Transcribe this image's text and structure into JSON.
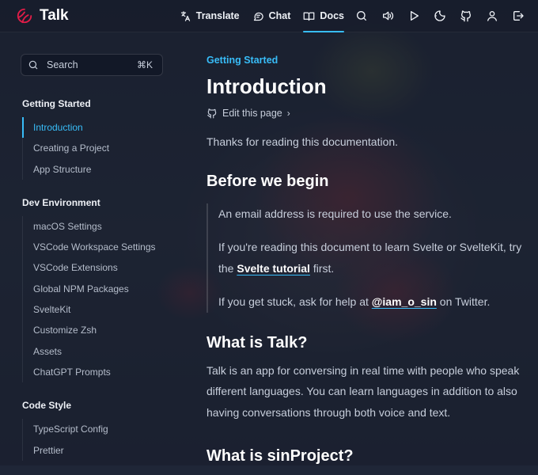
{
  "app": {
    "name": "Talk"
  },
  "nav": {
    "translate": "Translate",
    "chat": "Chat",
    "docs": "Docs"
  },
  "icons": [
    "logo-mark",
    "translate-icon",
    "chat-icon",
    "book-icon",
    "search-icon",
    "speaker-icon",
    "play-icon",
    "moon-icon",
    "github-icon",
    "user-icon",
    "logout-icon"
  ],
  "colors": {
    "accent": "#38bdf8",
    "heading": "#ffffff",
    "text": "#c7cedb",
    "logo": "#e11d48"
  },
  "search": {
    "label": "Search",
    "shortcut": "⌘K"
  },
  "sidebar": {
    "groups": [
      {
        "title": "Getting Started",
        "items": [
          "Introduction",
          "Creating a Project",
          "App Structure"
        ]
      },
      {
        "title": "Dev Environment",
        "items": [
          "macOS Settings",
          "VSCode Workspace Settings",
          "VSCode Extensions",
          "Global NPM Packages",
          "SvelteKit",
          "Customize Zsh",
          "Assets",
          "ChatGPT Prompts"
        ]
      },
      {
        "title": "Code Style",
        "items": [
          "TypeScript Config",
          "Prettier"
        ]
      }
    ],
    "active_item": "Introduction"
  },
  "main": {
    "eyebrow": "Getting Started",
    "title": "Introduction",
    "edit_link": "Edit this page",
    "intro": "Thanks for reading this documentation.",
    "before_heading": "Before we begin",
    "before": {
      "line1": "An email address is required to use the service.",
      "line2_pre": "If you're reading this document to learn Svelte or SvelteKit, try the ",
      "line2_link": "Svelte tutorial",
      "line2_post": " first.",
      "line3_pre": "If you get stuck, ask for help at ",
      "line3_link": "@iam_o_sin",
      "line3_post": " on Twitter."
    },
    "what_heading": "What is Talk?",
    "what_text": "Talk is an app for conversing in real time with people who speak different languages. You can learn languages in addition to also having conversations through both voice and text.",
    "sin_heading": "What is sinProject?"
  }
}
